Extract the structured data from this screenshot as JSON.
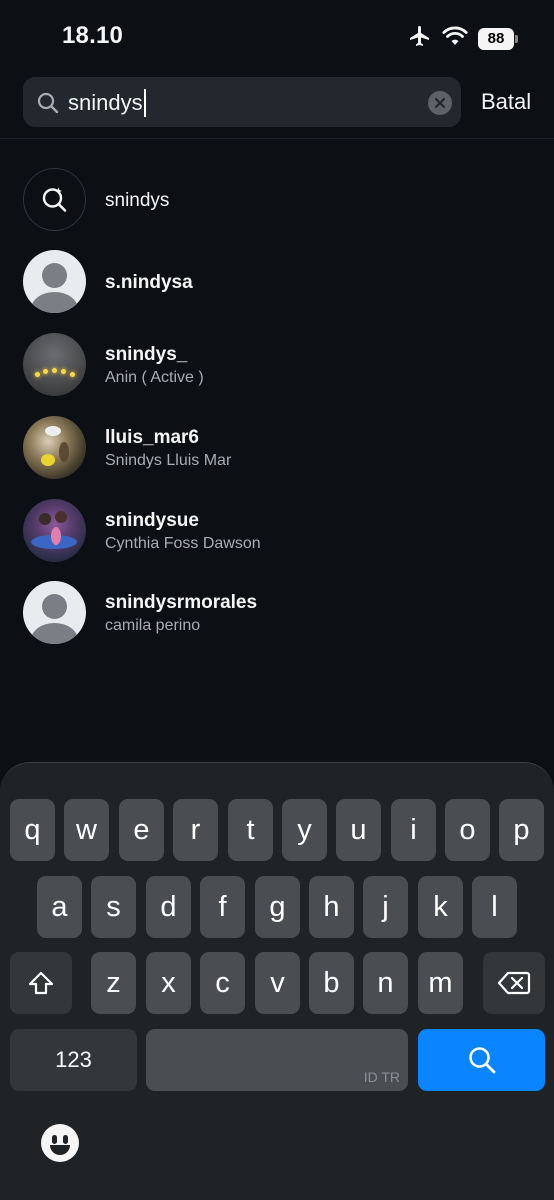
{
  "status": {
    "time": "18.10",
    "battery": "88"
  },
  "search": {
    "query": "snindys",
    "cancel_label": "Batal"
  },
  "results": [
    {
      "type": "query",
      "username": "snindys"
    },
    {
      "type": "user",
      "username": "s.nindysa",
      "fullname": ""
    },
    {
      "type": "user",
      "username": "snindys_",
      "fullname": "Anin ( Active )"
    },
    {
      "type": "user",
      "username": "lluis_mar6",
      "fullname": "Snindys Lluis Mar"
    },
    {
      "type": "user",
      "username": "snindysue",
      "fullname": "Cynthia Foss Dawson"
    },
    {
      "type": "user",
      "username": "snindysrmorales",
      "fullname": "camila perino"
    }
  ],
  "keyboard": {
    "row1": [
      "q",
      "w",
      "e",
      "r",
      "t",
      "y",
      "u",
      "i",
      "o",
      "p"
    ],
    "row2": [
      "a",
      "s",
      "d",
      "f",
      "g",
      "h",
      "j",
      "k",
      "l"
    ],
    "row3": [
      "z",
      "x",
      "c",
      "v",
      "b",
      "n",
      "m"
    ],
    "numbers_label": "123",
    "space_hint": "ID TR",
    "search_key_icon": "search-icon",
    "accent_color": "#0a84ff"
  }
}
